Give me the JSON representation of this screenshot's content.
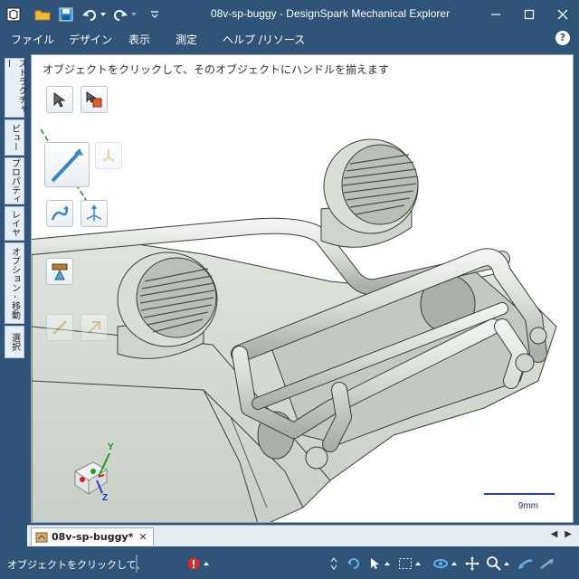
{
  "window": {
    "title": "08v-sp-buggy - DesignSpark Mechanical Explorer"
  },
  "menu": {
    "items": [
      "ファイル",
      "デザイン",
      "表示",
      "測定",
      "ヘルプ /リソース"
    ],
    "help_symbol": "?"
  },
  "side_tabs": [
    "ストラクチャー",
    "ビュー",
    "プロパティ",
    "レイヤ",
    "オプション - 移動",
    "選択"
  ],
  "viewport": {
    "hint": "オブジェクトをクリックして、そのオブジェクトにハンドルを揃えます",
    "scale_label": "9mm",
    "triad": {
      "y": "Y",
      "z": "Z"
    }
  },
  "document_tab": {
    "label": "08v-sp-buggy*",
    "close": "✕"
  },
  "status": {
    "text": "オブジェクトをクリックして、"
  },
  "colors": {
    "chrome": "#2f5477",
    "model_body": "#d3d9d1",
    "model_edge": "#3a3f3a",
    "scale_bar": "#2b3fb5"
  }
}
